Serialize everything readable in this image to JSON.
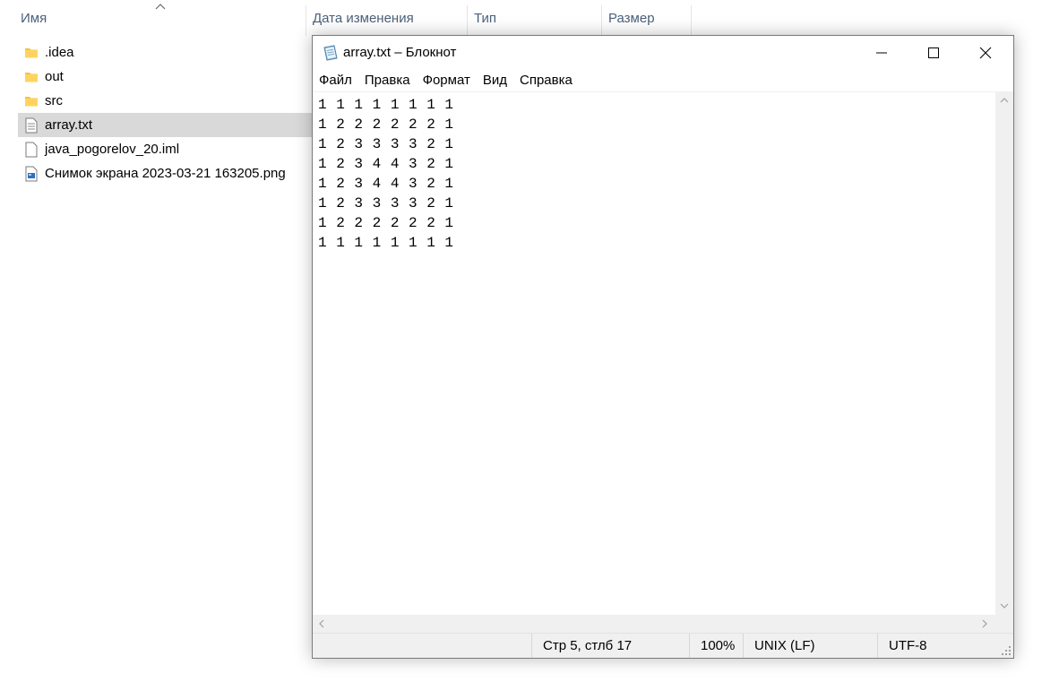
{
  "explorer": {
    "columns": [
      {
        "label": "Имя"
      },
      {
        "label": "Дата изменения"
      },
      {
        "label": "Тип"
      },
      {
        "label": "Размер"
      }
    ],
    "files": [
      {
        "name": ".idea",
        "icon": "folder-icon"
      },
      {
        "name": "out",
        "icon": "folder-icon"
      },
      {
        "name": "src",
        "icon": "folder-icon"
      },
      {
        "name": "array.txt",
        "icon": "text-file-icon",
        "selected": true
      },
      {
        "name": "java_pogorelov_20.iml",
        "icon": "blank-file-icon"
      },
      {
        "name": "Снимок экрана 2023-03-21 163205.png",
        "icon": "image-file-icon"
      }
    ],
    "colors": {
      "header_text": "#4c607a",
      "selected_row": "#d9d9d9",
      "folder": "#f5c242"
    }
  },
  "notepad": {
    "title": "array.txt – Блокнот",
    "menu": [
      "Файл",
      "Правка",
      "Формат",
      "Вид",
      "Справка"
    ],
    "lines": [
      "1 1 1 1 1 1 1 1",
      "1 2 2 2 2 2 2 1",
      "1 2 3 3 3 3 2 1",
      "1 2 3 4 4 3 2 1",
      "1 2 3 4 4 3 2 1",
      "1 2 3 3 3 3 2 1",
      "1 2 2 2 2 2 2 1",
      "1 1 1 1 1 1 1 1"
    ],
    "status": {
      "position": "Стр 5, стлб 17",
      "zoom": "100%",
      "line_ending": "UNIX (LF)",
      "encoding": "UTF-8"
    }
  }
}
